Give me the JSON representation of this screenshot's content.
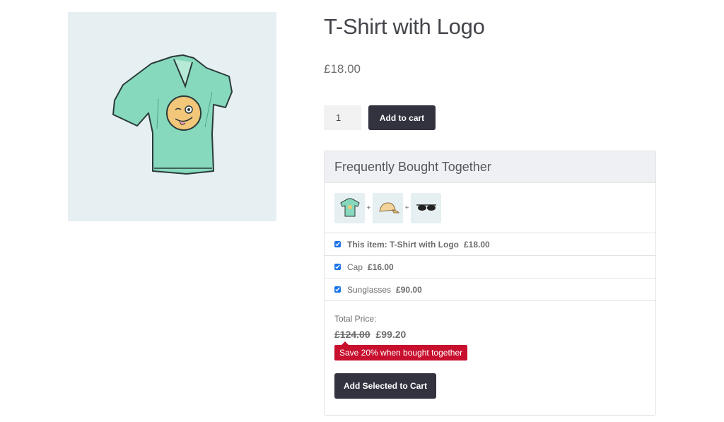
{
  "product": {
    "title": "T-Shirt with Logo",
    "price": "£18.00",
    "quantity": "1",
    "add_to_cart_label": "Add to cart",
    "image_icon": "tshirt-image"
  },
  "fbt": {
    "title": "Frequently Bought Together",
    "thumbnails": [
      {
        "icon": "tshirt-thumbnail"
      },
      {
        "icon": "cap-thumbnail"
      },
      {
        "icon": "sunglasses-thumbnail"
      }
    ],
    "plus_sign": "+",
    "items": [
      {
        "name": "This item: T-Shirt with Logo",
        "price": "£18.00",
        "checked": true
      },
      {
        "name": "Cap",
        "price": "£16.00",
        "checked": true
      },
      {
        "name": "Sunglasses",
        "price": "£90.00",
        "checked": true
      }
    ],
    "total_label": "Total Price:",
    "total_original": "£124.00",
    "total_discounted": "£99.20",
    "save_badge": "Save 20% when bought together",
    "add_selected_label": "Add Selected to Cart"
  },
  "colors": {
    "button_bg": "#333340",
    "badge_bg": "#c8102e",
    "image_bg": "#e6eff2",
    "tshirt": "#86d9bc"
  }
}
